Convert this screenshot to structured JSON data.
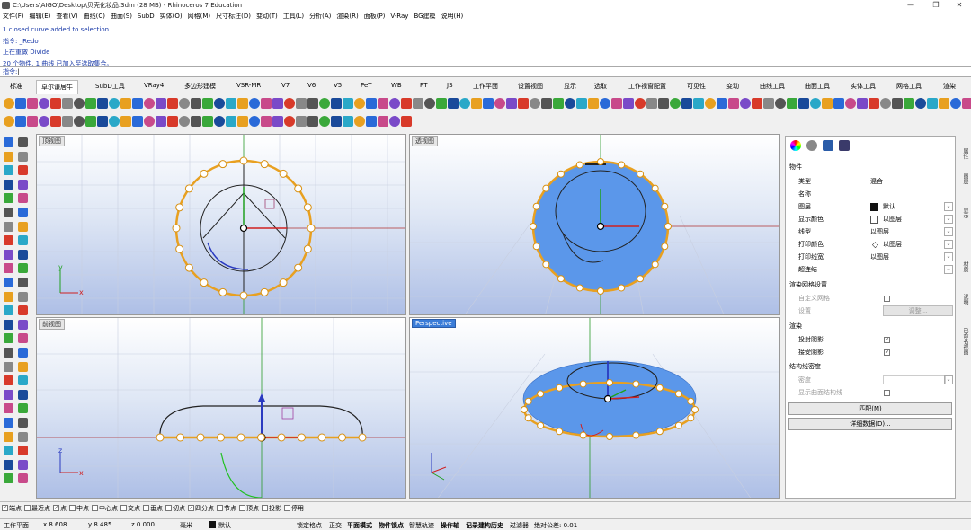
{
  "title": "C:\\Users\\AIGO\\Desktop\\贝壳化妆品.3dm (28 MB) - Rhinoceros 7 Education",
  "menu": [
    "文件(F)",
    "编辑(E)",
    "查看(V)",
    "曲线(C)",
    "曲面(S)",
    "SubD",
    "实体(O)",
    "网格(M)",
    "尺寸标注(D)",
    "变动(T)",
    "工具(L)",
    "分析(A)",
    "渲染(R)",
    "面板(P)",
    "V-Ray",
    "BG建模",
    "说明(H)"
  ],
  "history": [
    "1 closed curve added to selection.",
    "指令: _Redo",
    "正在重做 Divide",
    "20 个物件, 1 曲线 已加入至选取集合。"
  ],
  "prompt": "指令:",
  "tabs": [
    "标准",
    "卓尔谦居牛",
    "SubD工具",
    "VRay4",
    "多边形建模",
    "VSR-MR",
    "V7",
    "V6",
    "V5",
    "PeT",
    "WB",
    "PT",
    "JS",
    "工作平面",
    "设置视图",
    "显示",
    "选取",
    "工作视窗配置",
    "可见性",
    "变动",
    "曲线工具",
    "曲面工具",
    "实体工具",
    "网格工具",
    "渲染"
  ],
  "active_tab": "卓尔谦居牛",
  "viewports": {
    "top": "顶视图",
    "perspective_tl": "透视图",
    "front": "前视图",
    "perspective": "Perspective"
  },
  "axes": {
    "x": "x",
    "y": "y",
    "z": "z"
  },
  "props": {
    "section": "物件",
    "rows": [
      {
        "k": "类型",
        "v": "混合"
      },
      {
        "k": "名称",
        "v": ""
      },
      {
        "k": "图层",
        "v": "默认"
      },
      {
        "k": "显示颜色",
        "v": "以图层"
      },
      {
        "k": "线型",
        "v": "以图层"
      },
      {
        "k": "打印颜色",
        "v": "以图层"
      },
      {
        "k": "打印线宽",
        "v": "以图层"
      },
      {
        "k": "超连结",
        "v": ""
      }
    ],
    "mesh_section": "渲染网格设置",
    "custom_mesh": "自定义网格",
    "settings": "设置",
    "adjust": "调整...",
    "render_section": "渲染",
    "cast_shadow": "投射阴影",
    "recv_shadow": "接受阴影",
    "iso_section": "结构线密度",
    "density": "密度",
    "show_iso": "显示曲面结构线",
    "match_btn": "匹配(M)",
    "detail_btn": "详细数据(D)..."
  },
  "sidetabs": [
    "属性",
    "图层",
    "显示",
    "材质",
    "说明",
    "已命名视图"
  ],
  "osnaps": [
    {
      "label": "端点",
      "on": true
    },
    {
      "label": "最近点",
      "on": false
    },
    {
      "label": "点",
      "on": true
    },
    {
      "label": "中点",
      "on": false
    },
    {
      "label": "中心点",
      "on": false
    },
    {
      "label": "交点",
      "on": false
    },
    {
      "label": "垂点",
      "on": false
    },
    {
      "label": "切点",
      "on": false
    },
    {
      "label": "四分点",
      "on": true
    },
    {
      "label": "节点",
      "on": false
    },
    {
      "label": "顶点",
      "on": false
    },
    {
      "label": "投影",
      "on": false
    },
    {
      "label": "停用",
      "on": false
    }
  ],
  "status": {
    "cplane": "工作平面",
    "x": "x 8.608",
    "y": "y 8.485",
    "z": "z 0.000",
    "unit": "毫米",
    "layer": "默认",
    "grid_snap": "锁定格点",
    "ortho": "正交",
    "planar": "平面模式",
    "osnap": "物件锁点",
    "smart": "智慧轨迹",
    "gumball": "操作轴",
    "history": "记录建构历史",
    "filter": "过滤器",
    "tolerance": "绝对公差: 0.01"
  }
}
